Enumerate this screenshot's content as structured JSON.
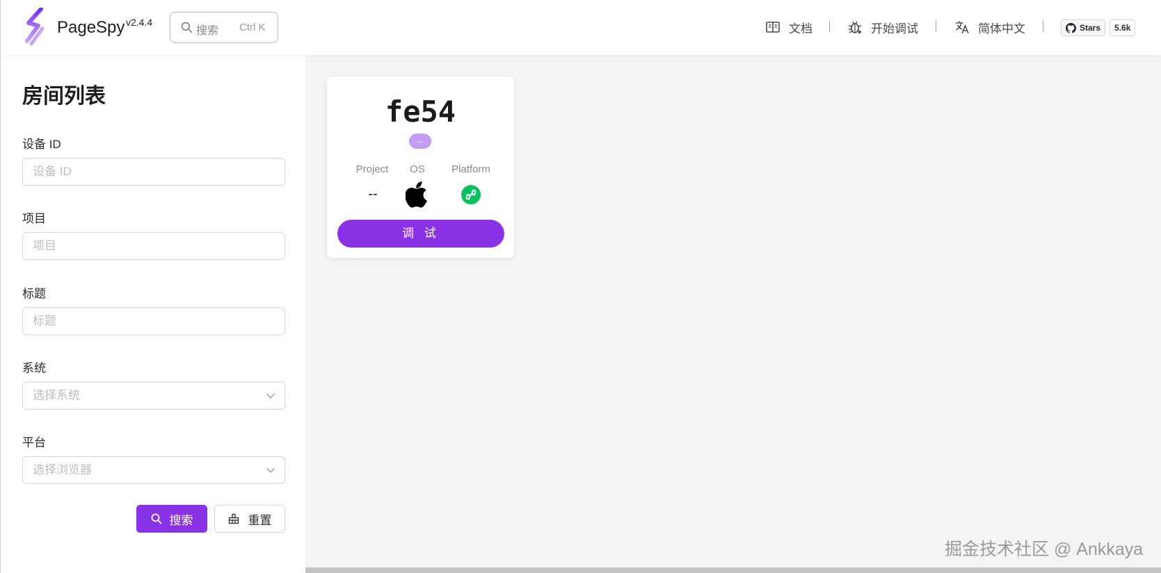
{
  "header": {
    "brand": "PageSpy",
    "version": "v2.4.4",
    "search": {
      "placeholder": "搜索",
      "shortcut": "Ctrl K"
    },
    "nav": [
      {
        "label": "文档",
        "icon": "book-icon"
      },
      {
        "label": "开始调试",
        "icon": "bug-icon"
      },
      {
        "label": "简体中文",
        "icon": "translate-icon"
      }
    ],
    "github": {
      "label": "Stars",
      "count": "5.6k"
    }
  },
  "sidebar": {
    "title": "房间列表",
    "fields": [
      {
        "label": "设备 ID",
        "placeholder": "设备 ID"
      },
      {
        "label": "项目",
        "placeholder": "项目"
      },
      {
        "label": "标题",
        "placeholder": "标题"
      },
      {
        "label": "系统",
        "placeholder": "选择系统"
      },
      {
        "label": "平台",
        "placeholder": "选择浏览器"
      }
    ],
    "search_button": "搜索",
    "reset_button": "重置"
  },
  "rooms": [
    {
      "id": "fe54",
      "tag": "--",
      "project_label": "Project",
      "project_value": "--",
      "os_label": "OS",
      "os_icon": "apple-icon",
      "platform_label": "Platform",
      "platform_icon": "mini-program-icon",
      "action": "调 试"
    }
  ],
  "watermark": "掘金技术社区 @ Ankkaya",
  "colors": {
    "accent": "#8a33e6",
    "tag": "#c49cf2",
    "platform": "#07c160"
  }
}
